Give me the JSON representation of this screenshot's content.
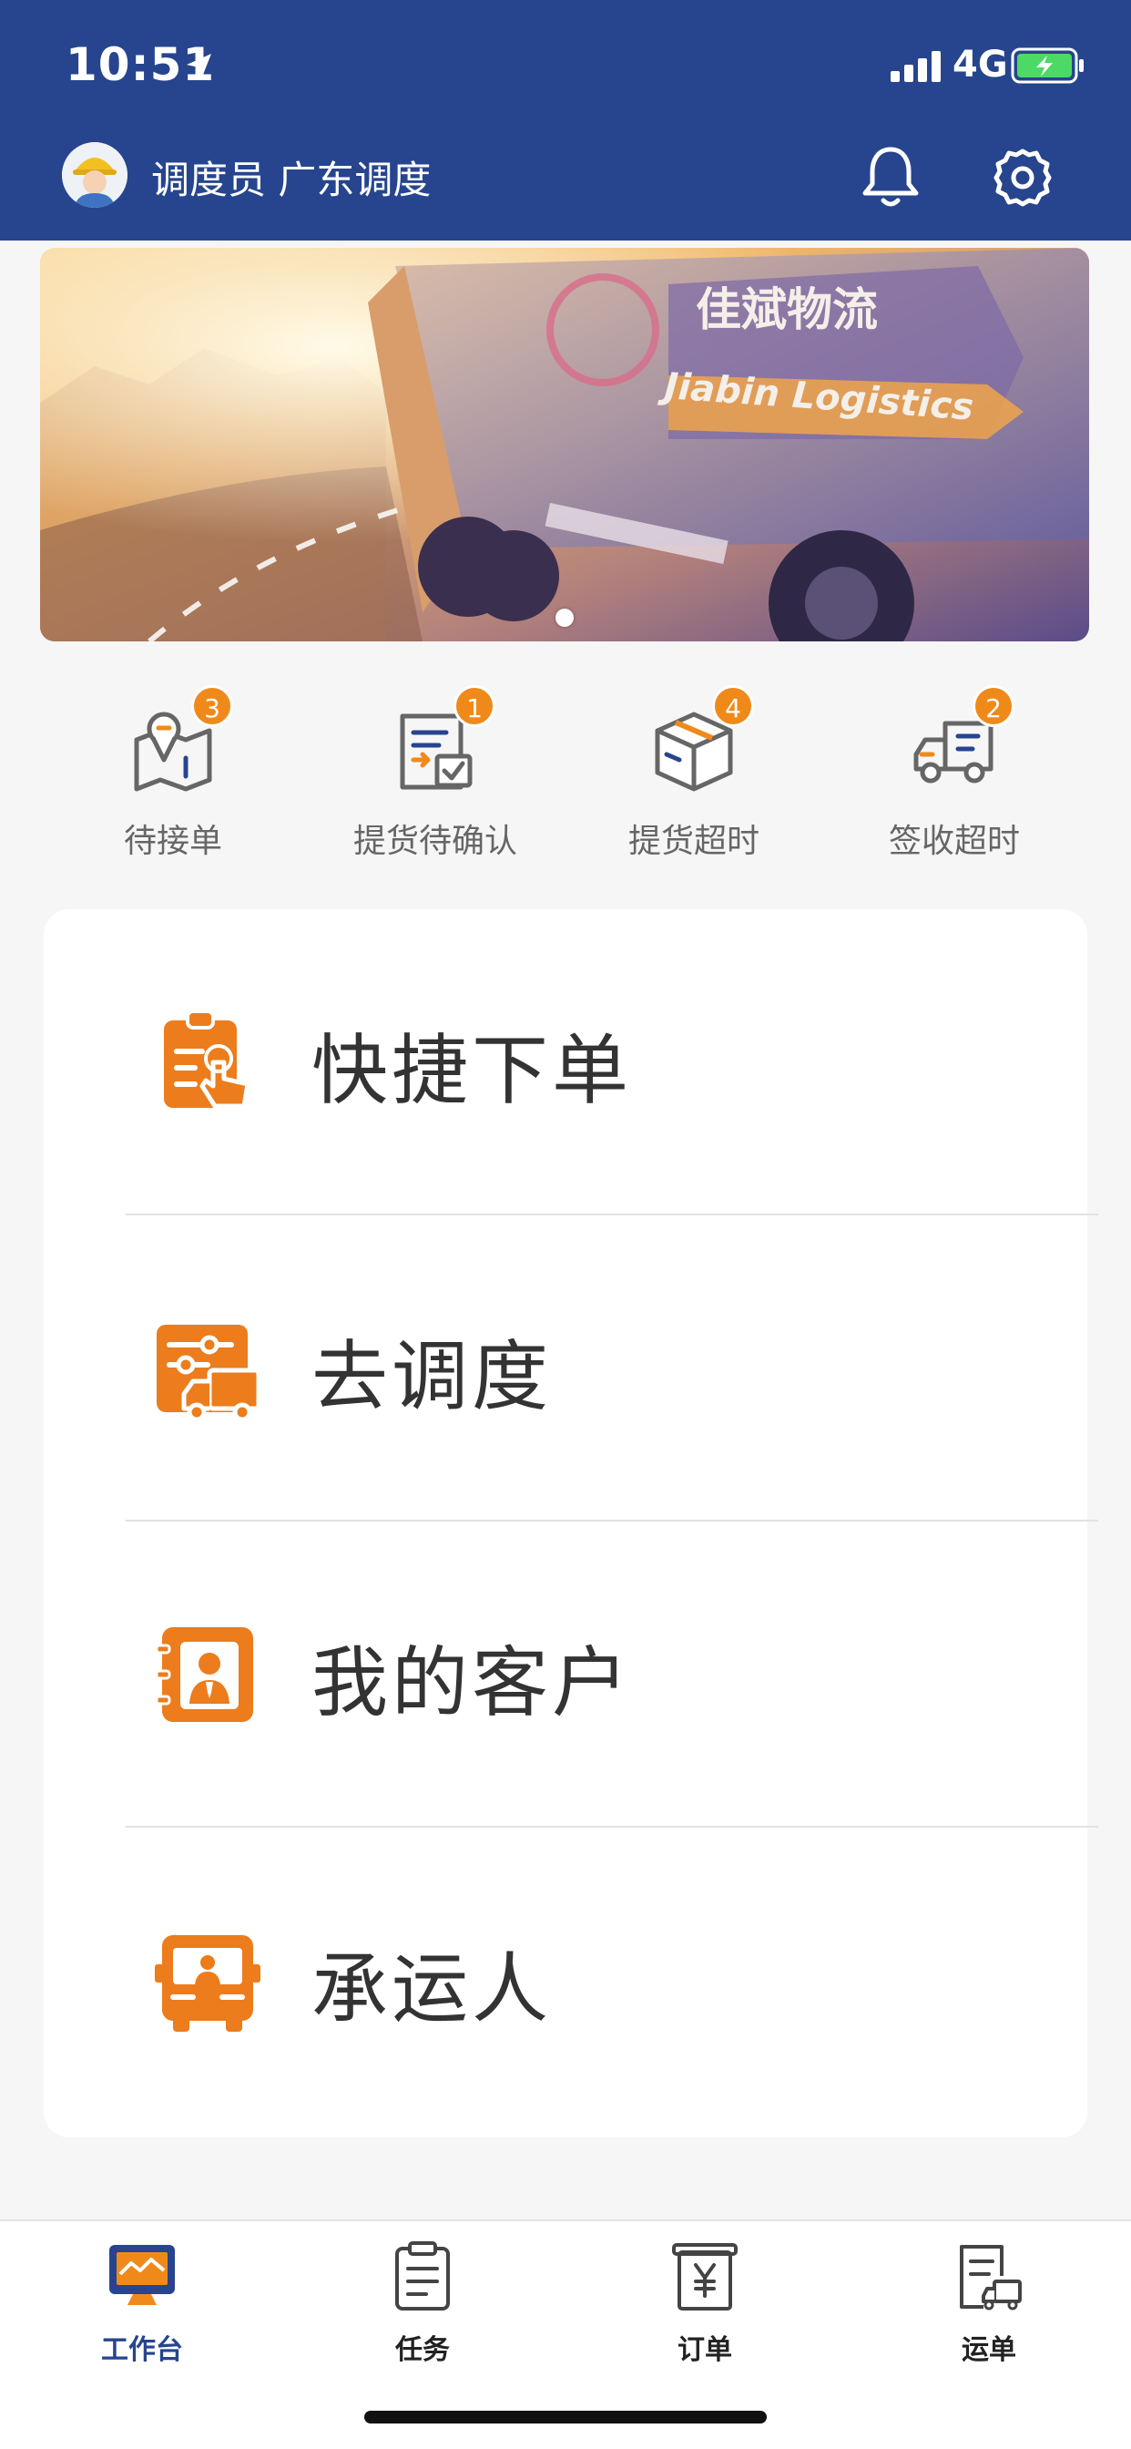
{
  "status_bar": {
    "time": "10:51",
    "network": "4G",
    "icons": [
      "location-arrow-icon",
      "signal-icon",
      "battery-charging-icon"
    ]
  },
  "header": {
    "user_name": "调度员 广东调度",
    "icons": [
      "avatar",
      "bell-icon",
      "gear-icon"
    ],
    "background_color": "#26458e"
  },
  "banner": {
    "brand_text_cn": "佳斌物流",
    "brand_text_en": "Jiabin Logistics",
    "page_indicator": "1 of 1"
  },
  "stats": [
    {
      "label": "待接单",
      "count": "3",
      "icon": "map-pin-icon"
    },
    {
      "label": "提货待确认",
      "count": "1",
      "icon": "document-check-icon"
    },
    {
      "label": "提货超时",
      "count": "4",
      "icon": "package-box-icon"
    },
    {
      "label": "签收超时",
      "count": "2",
      "icon": "truck-icon"
    }
  ],
  "menu": [
    {
      "label": "快捷下单",
      "icon": "clipboard-tap-icon"
    },
    {
      "label": "去调度",
      "icon": "dispatch-truck-icon"
    },
    {
      "label": "我的客户",
      "icon": "contact-book-icon"
    },
    {
      "label": "承运人",
      "icon": "bus-driver-icon"
    }
  ],
  "tabbar": {
    "tabs": [
      {
        "label": "工作台",
        "icon": "monitor-icon",
        "active": true
      },
      {
        "label": "任务",
        "icon": "clipboard-icon",
        "active": false
      },
      {
        "label": "订单",
        "icon": "yen-receipt-icon",
        "active": false
      },
      {
        "label": "运单",
        "icon": "waybill-truck-icon",
        "active": false
      }
    ],
    "active_color": "#26458e",
    "accent_color": "#ef8a1a"
  }
}
